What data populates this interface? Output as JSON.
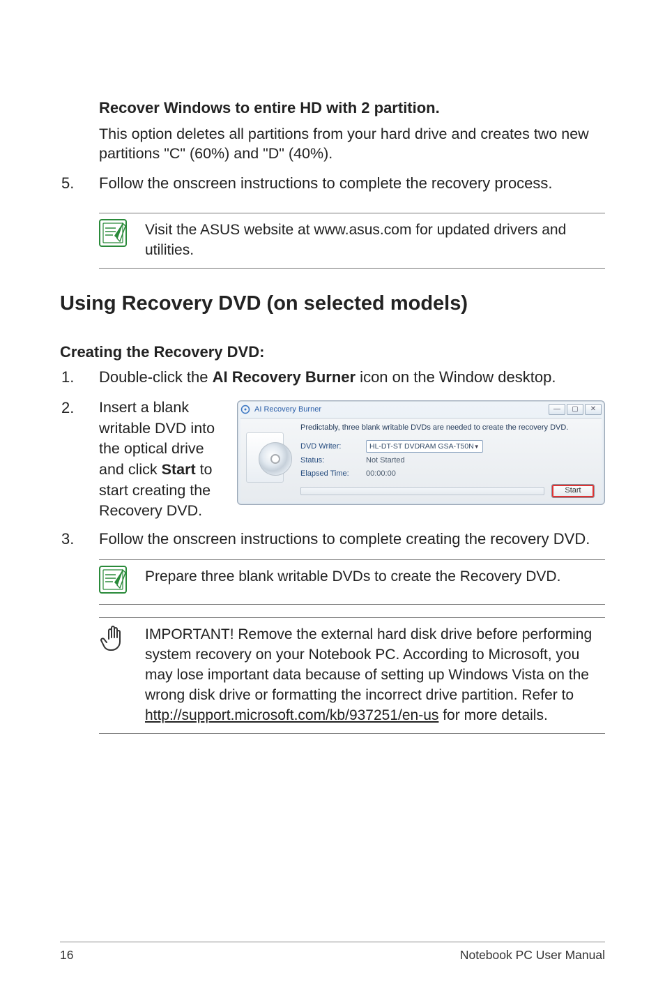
{
  "section0": {
    "heading": "Recover Windows to entire HD with 2 partition.",
    "body": "This option deletes all partitions from your hard drive and creates two new partitions \"C\" (60%) and \"D\" (40%)."
  },
  "step5": {
    "num": "5.",
    "text": "Follow the onscreen instructions to complete the recovery process."
  },
  "note1": "Visit the ASUS website at www.asus.com for updated drivers and utilities.",
  "h1": "Using Recovery DVD (on selected models)",
  "subhead": "Creating the Recovery DVD:",
  "step1": {
    "num": "1.",
    "pre": "Double-click the ",
    "bold": "AI Recovery Burner",
    "post": " icon on the Window desktop."
  },
  "step2": {
    "num": "2.",
    "pre": "Insert a blank writable DVD into the optical drive and click ",
    "bold": "Start",
    "post": " to start creating the Recovery DVD."
  },
  "window": {
    "title": "AI Recovery Burner",
    "msg": "Predictably, three blank writable DVDs are needed to create the recovery DVD.",
    "labels": {
      "writer": "DVD Writer:",
      "status": "Status:",
      "elapsed": "Elapsed Time:"
    },
    "values": {
      "writer": "HL-DT-ST DVDRAM GSA-T50N",
      "status": "Not Started",
      "elapsed": "00:00:00"
    },
    "start": "Start"
  },
  "step3": {
    "num": "3.",
    "text": "Follow the onscreen instructions to complete creating the recovery DVD."
  },
  "note2": "Prepare three blank writable DVDs to create the Recovery DVD.",
  "important": {
    "pre": "IMPORTANT! Remove the external hard disk drive before performing system recovery on your Notebook PC. According to Microsoft, you may lose important data because of setting up Windows Vista on the wrong disk drive or formatting the incorrect drive partition. Refer to ",
    "link": "http://support.microsoft.com/kb/937251/en-us",
    "post": " for more details."
  },
  "footer": {
    "page": "16",
    "title": "Notebook PC User Manual"
  }
}
